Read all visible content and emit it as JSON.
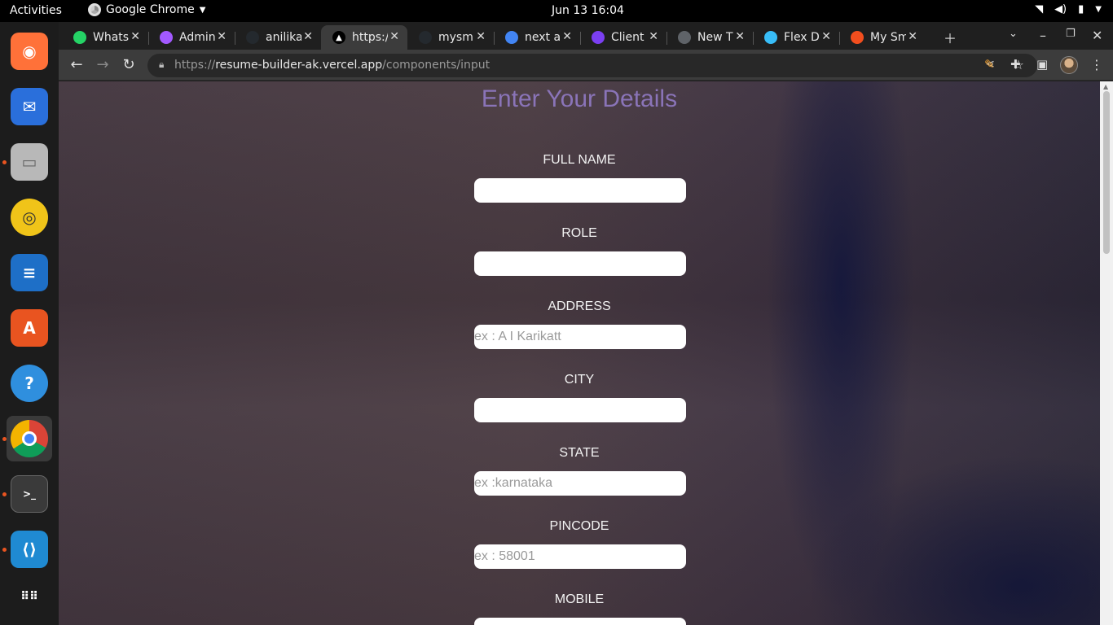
{
  "system": {
    "activities": "Activities",
    "app_name": "Google Chrome",
    "clock": "Jun 13  16:04",
    "tray_icons": [
      "wifi-icon",
      "volume-icon",
      "battery-icon",
      "power-menu-icon"
    ]
  },
  "dock": {
    "items": [
      {
        "name": "firefox",
        "color": "#ff7139",
        "glyph": "◉"
      },
      {
        "name": "thunderbird",
        "color": "#2a6fdb",
        "glyph": "✉"
      },
      {
        "name": "files",
        "color": "#b8b8b8",
        "glyph": "▭"
      },
      {
        "name": "rhythmbox",
        "color": "#f0c419",
        "glyph": "◎"
      },
      {
        "name": "libreoffice-writer",
        "color": "#1e6fc7",
        "glyph": "≡"
      },
      {
        "name": "app-center",
        "color": "#e95420",
        "glyph": "A"
      },
      {
        "name": "help",
        "color": "#2f8fde",
        "glyph": "?"
      },
      {
        "name": "chrome",
        "color": "#ffffff",
        "glyph": "●"
      },
      {
        "name": "terminal",
        "color": "#3a3a3a",
        "glyph": ">_"
      },
      {
        "name": "vscode",
        "color": "#1f8ad2",
        "glyph": "⟨⟩"
      },
      {
        "name": "show-apps",
        "color": "#1c1c1c",
        "glyph": "⋮⋮⋮"
      }
    ]
  },
  "tabs": [
    {
      "label": "WhatsApp",
      "fav_color": "#25d366"
    },
    {
      "label": "Admin",
      "fav_color": "#a259ff"
    },
    {
      "label": "anilika",
      "fav_color": "#24292e"
    },
    {
      "label": "https://",
      "fav_color": "#000000"
    },
    {
      "label": "mysmart",
      "fav_color": "#24292e"
    },
    {
      "label": "next auth",
      "fav_color": "#4285f4"
    },
    {
      "label": "Client",
      "fav_color": "#7b3ff2"
    },
    {
      "label": "New Tab",
      "fav_color": "#5f6368"
    },
    {
      "label": "Flex Direction",
      "fav_color": "#38bdf8"
    },
    {
      "label": "My Smart",
      "fav_color": "#f24e1e"
    }
  ],
  "tab_labels_visible": [
    "Whats",
    "Admin",
    "anilika",
    "https:/",
    "mysm",
    "next a",
    "Client",
    "New T",
    "Flex D",
    "My Sm"
  ],
  "toolbar": {
    "url_prefix": "https://",
    "url_host": "resume-builder-ak.vercel.app",
    "url_path": "/components/input"
  },
  "form": {
    "title": "Enter Your Details",
    "fields": [
      {
        "label": "FULL NAME",
        "value": "",
        "placeholder": ""
      },
      {
        "label": "ROLE",
        "value": "",
        "placeholder": ""
      },
      {
        "label": "ADDRESS",
        "value": "",
        "placeholder": "ex : A I Karikatt"
      },
      {
        "label": "CITY",
        "value": "",
        "placeholder": ""
      },
      {
        "label": "STATE",
        "value": "",
        "placeholder": "ex :karnataka"
      },
      {
        "label": "PINCODE",
        "value": "",
        "placeholder": "ex : 58001"
      },
      {
        "label": "MOBILE",
        "value": "",
        "placeholder": ""
      }
    ]
  }
}
